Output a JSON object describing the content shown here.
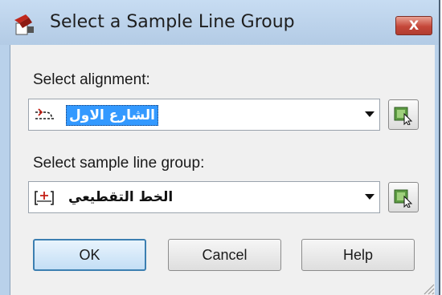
{
  "dialog": {
    "title": "Select a Sample Line Group",
    "close_label": "X"
  },
  "alignment": {
    "label": "Select alignment:",
    "selected_value": "الشارع الاول",
    "icon": "alignment-icon"
  },
  "sample_line_group": {
    "label": "Select sample line group:",
    "selected_value": "الخط التقطيعي",
    "icon": "sample-line-icon"
  },
  "buttons": {
    "ok": "OK",
    "cancel": "Cancel",
    "help": "Help"
  },
  "colors": {
    "title_bar": "#b9d1ea",
    "close_button": "#c5473a",
    "selection": "#3399ff",
    "default_button_border": "#3c7fb1"
  }
}
